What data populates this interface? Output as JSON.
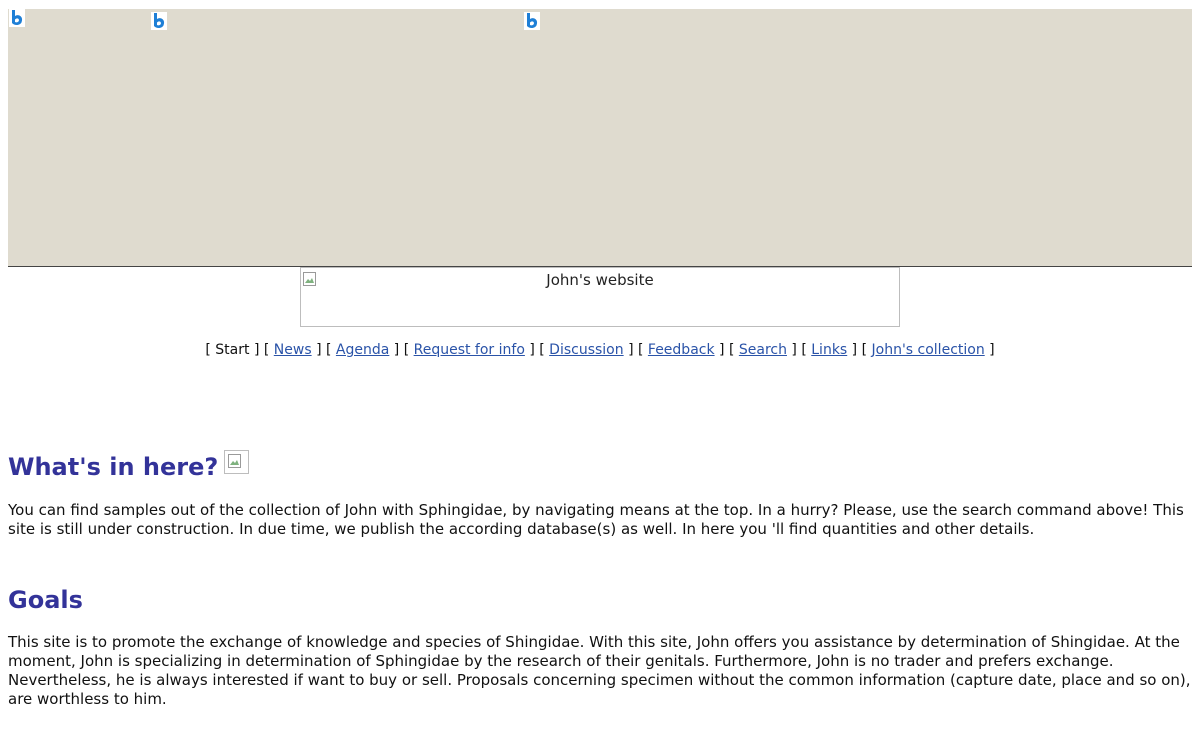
{
  "banner": {
    "background": "#dfdbcf",
    "icons": [
      "bing-icon",
      "bing-icon",
      "bing-icon"
    ]
  },
  "logo": {
    "alt_text": "John's website"
  },
  "nav": {
    "items": [
      {
        "label": "Start",
        "current": true
      },
      {
        "label": "News"
      },
      {
        "label": "Agenda"
      },
      {
        "label": "Request for info"
      },
      {
        "label": "Discussion"
      },
      {
        "label": "Feedback"
      },
      {
        "label": "Search"
      },
      {
        "label": "Links"
      },
      {
        "label": "John's collection"
      }
    ],
    "link_color": "#2a53a8"
  },
  "sections": [
    {
      "heading": "What's in here?",
      "text": "You can find samples out of the collection of John with Sphingidae, by navigating means at the top. In a hurry? Please, use the search command above! This site is still under construction. In due time, we publish the according database(s) as well. In here you 'll find quantities and other details."
    },
    {
      "heading": "Goals",
      "text": "This site is to promote the exchange of knowledge and species of Shingidae. With this site, John offers you assistance by determination of Shingidae. At the moment, John is specializing in determination of Sphingidae by the research of their genitals. Furthermore, John is no trader and prefers exchange. Nevertheless, he is always interested if want to buy or sell. Proposals concerning specimen without the common information (capture date, place and so on), are worthless to him."
    }
  ],
  "colors": {
    "heading": "#333399",
    "banner": "#dfdbcf"
  }
}
